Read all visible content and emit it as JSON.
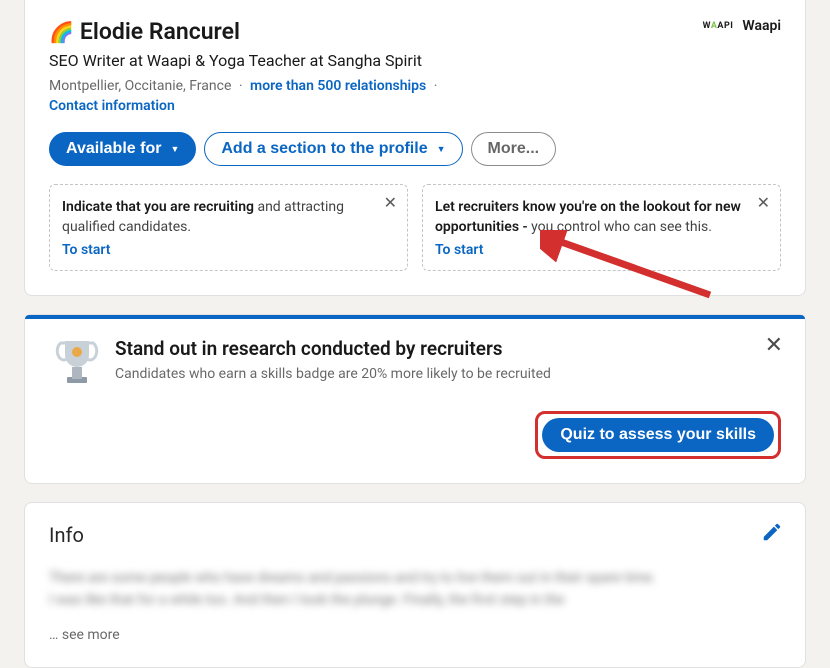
{
  "profile": {
    "emoji": "🌈",
    "name": "Elodie Rancurel",
    "company_logo": "WAAPI",
    "company_name": "Waapi",
    "headline": "SEO Writer at Waapi & Yoga Teacher at Sangha Spirit",
    "location": "Montpellier, Occitanie, France",
    "relationships": "more than 500 relationships",
    "contact_label": "Contact information"
  },
  "buttons": {
    "available": "Available for",
    "add_section": "Add a section to the profile",
    "more": "More..."
  },
  "box_recruit": {
    "bold": "Indicate that you are recruiting",
    "rest": " and attracting qualified candidates.",
    "start": "To start"
  },
  "box_lookout": {
    "bold": "Let recruiters know you're on the lookout for new opportunities -",
    "rest": " you control who can see this.",
    "start": "To start"
  },
  "promo": {
    "title": "Stand out in research conducted by recruiters",
    "subtitle": "Candidates who earn a skills badge are 20% more likely to be recruited",
    "quiz_button": "Quiz to assess your skills"
  },
  "info": {
    "title": "Info",
    "see_more": "… see more",
    "blurred_line1": "There are some people who have dreams and passions and try to live them out in their spare time.",
    "blurred_line2": "I was like that for a while too.    And then I took the plunge. Finally, the first step in the"
  }
}
